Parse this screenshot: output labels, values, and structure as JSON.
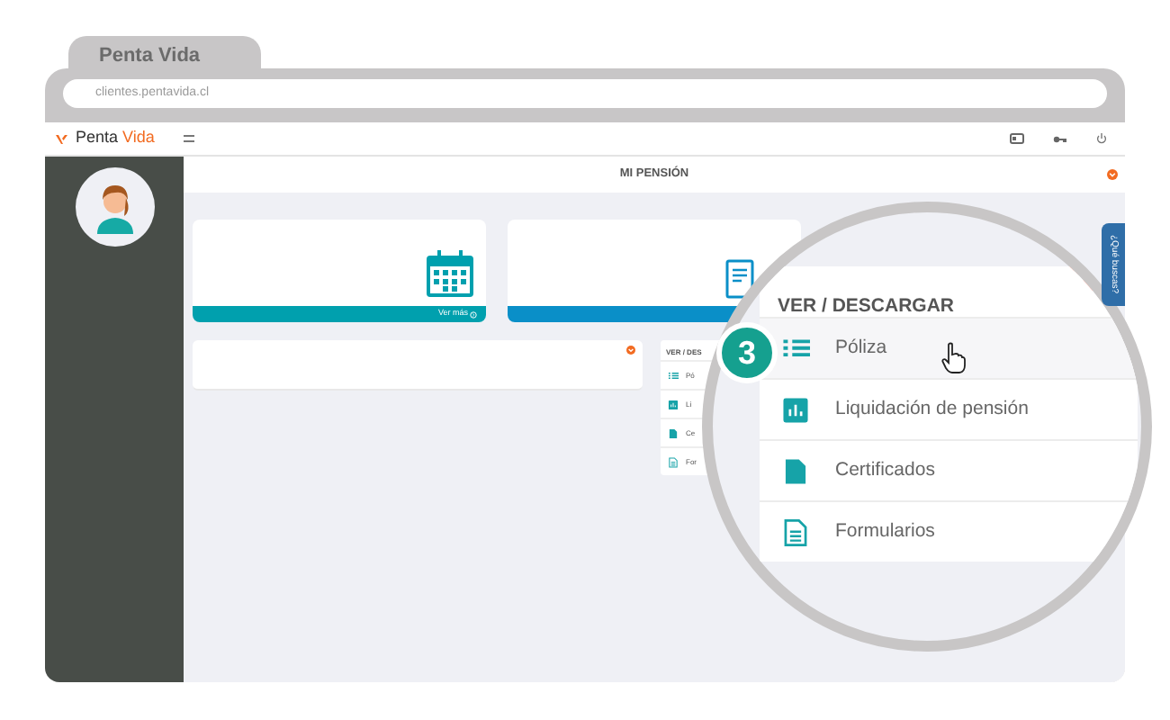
{
  "browser": {
    "tab_title": "Penta Vida",
    "address": "clientes.pentavida.cl"
  },
  "logo": [
    "Penta",
    "Vida"
  ],
  "page_title": "MI PENSIÓN",
  "cards": [
    {
      "kind": "calendar",
      "footer": "Ver más",
      "color": "#00a0ae"
    },
    {
      "kind": "document",
      "color": "#0a8fc8"
    }
  ],
  "small_panel": {
    "title": "VER / DES",
    "items": [
      {
        "kind": "list",
        "label": "Pó"
      },
      {
        "kind": "chart",
        "label": "Li"
      },
      {
        "kind": "file",
        "label": "Ce"
      },
      {
        "kind": "form",
        "label": "For"
      }
    ]
  },
  "magnifier": {
    "step": "3",
    "side_tab": "¿Qué buscas?",
    "panel": {
      "title": "VER / DESCARGAR",
      "items": [
        {
          "kind": "list",
          "label": "Póliza",
          "hovered": true
        },
        {
          "kind": "chart",
          "label": "Liquidación de pensión",
          "hovered": false
        },
        {
          "kind": "file",
          "label": "Certificados",
          "hovered": false
        },
        {
          "kind": "form",
          "label": "Formularios",
          "hovered": false
        }
      ]
    }
  }
}
